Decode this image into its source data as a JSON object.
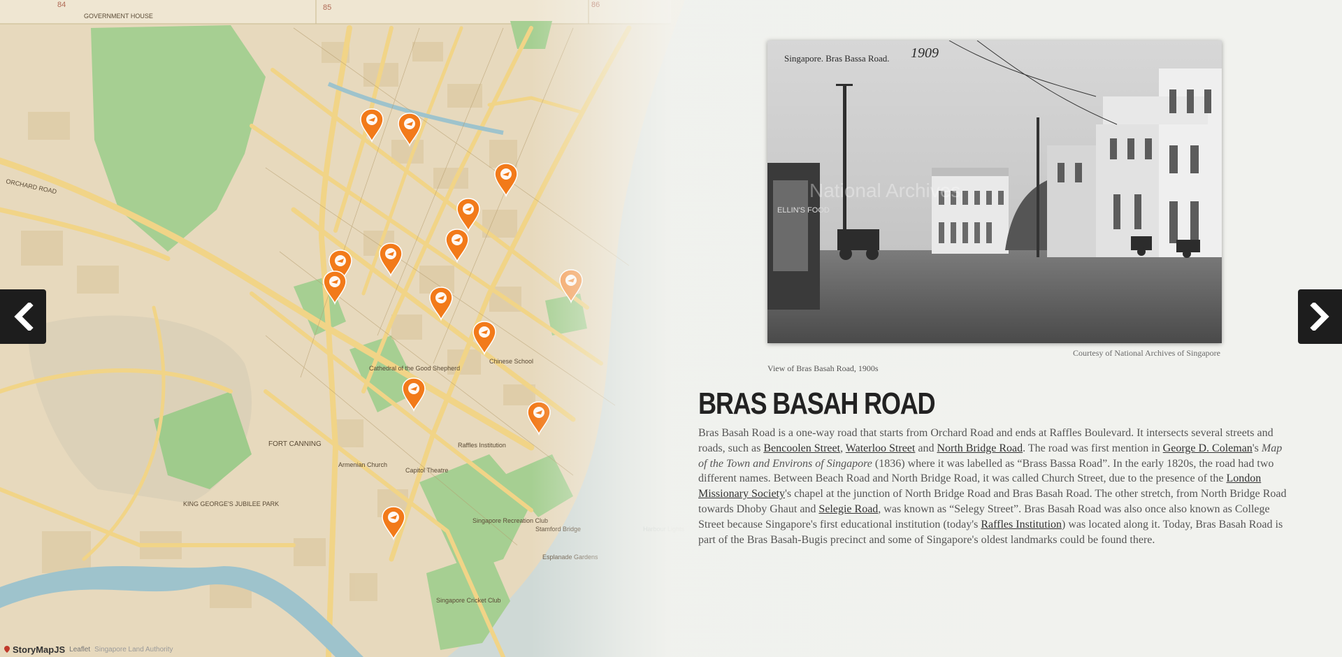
{
  "map": {
    "grid_numbers": [
      "84",
      "85",
      "86"
    ],
    "place_labels": [
      "GOVERNMENT HOUSE",
      "ORCHARD ROAD",
      "FORT CANNING",
      "KING GEORGE'S JUBILEE PARK",
      "Raffles Institution",
      "Singapore Recreation Club",
      "Capitol Theatre",
      "Singapore Cricket Club",
      "Stamford Bridge",
      "Esplanade Gardens",
      "Armenian Church",
      "Cathedral of the Good Shepherd",
      "Chinese School",
      "Harbour Lights"
    ],
    "markers": [
      {
        "name": "marker",
        "color": "#f27a1a"
      },
      {
        "name": "marker-active",
        "color": "#f5a05a"
      }
    ]
  },
  "slide": {
    "photo_title": "Singapore. Bras Bassa Road.",
    "photo_year": "1909",
    "photo_shop_sign": "ELLIN'S FOOD",
    "photo_watermark": "National Archives",
    "credit": "Courtesy of National Archives of Singapore",
    "caption": "View of Bras Basah Road, 1900s",
    "headline": "BRAS BASAH ROAD",
    "body": {
      "s1": "Bras Basah Road is a one-way road that starts from Orchard Road and ends at Raffles Boulevard. It intersects several streets and roads, such as ",
      "link1": "Bencoolen Street",
      "s2": ", ",
      "link2": "Waterloo Street",
      "s3": " and ",
      "link3": "North Bridge Road",
      "s4": ". The road was first mention in ",
      "link4": "George D. Coleman",
      "s5": "'s ",
      "italic": "Map of the Town and Environs of Singapore",
      "s6": " (1836) where it was labelled as “Brass Bassa Road”. In the early 1820s, the road had two different names. Between Beach Road and North Bridge Road, it was called Church Street, due to the presence of the ",
      "link5": "London Missionary Society",
      "s7": "'s chapel at the junction of North Bridge Road and Bras Basah Road. The other stretch, from North Bridge Road towards Dhoby Ghaut and ",
      "link6": "Selegie Road",
      "s8": ", was known as “Selegy Street”. Bras Basah Road was also once also known as College Street because Singapore's first educational institution (today's ",
      "link7": "Raffles Institution",
      "s9": ") was located along it. Today, Bras Basah Road is part of the Bras Basah-Bugis precinct and some of Singapore's oldest landmarks could be found there."
    }
  },
  "nav": {
    "prev_icon": "chevron-left-icon",
    "next_icon": "chevron-right-icon"
  },
  "attribution": {
    "brand": "StoryMapJS",
    "leaflet": "Leaflet",
    "source": "Singapore Land Authority"
  },
  "colors": {
    "marker": "#f27a1a",
    "map_bg": "#e8dcc0",
    "park": "#9cc98a",
    "road": "#f2d78a",
    "sea": "#c9d7d8"
  }
}
